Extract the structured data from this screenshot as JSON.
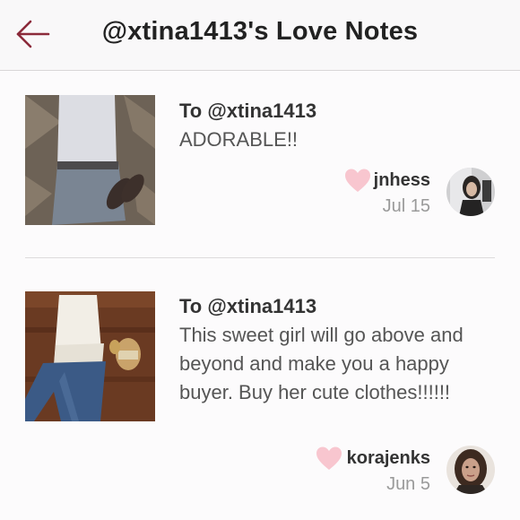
{
  "header": {
    "title": "@xtina1413's Love Notes"
  },
  "notes": [
    {
      "to": "To @xtina1413",
      "message": "ADORABLE!!",
      "username": "jnhess",
      "date": "Jul 15"
    },
    {
      "to": "To @xtina1413",
      "message": "This sweet girl will go above and beyond and make you a happy buyer. Buy her cute clothes!!!!!!",
      "username": "korajenks",
      "date": "Jun 5"
    }
  ],
  "icons": {
    "back": "back-arrow-icon",
    "heart": "heart-icon"
  },
  "colors": {
    "accent": "#8b2a3a",
    "heart": "#f8c6cf"
  }
}
